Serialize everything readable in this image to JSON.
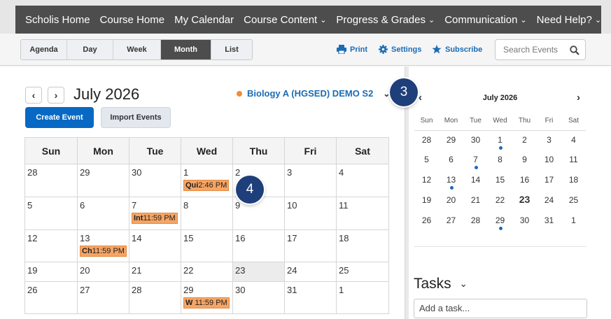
{
  "topnav": {
    "items": [
      {
        "label": "Scholis Home",
        "chevron": false
      },
      {
        "label": "Course Home",
        "chevron": false
      },
      {
        "label": "My Calendar",
        "chevron": false
      },
      {
        "label": "Course Content",
        "chevron": true
      },
      {
        "label": "Progress & Grades",
        "chevron": true
      },
      {
        "label": "Communication",
        "chevron": true
      },
      {
        "label": "Need Help?",
        "chevron": true
      }
    ]
  },
  "toolbar": {
    "views": [
      "Agenda",
      "Day",
      "Week",
      "Month",
      "List"
    ],
    "active_view": "Month",
    "print_label": "Print",
    "settings_label": "Settings",
    "subscribe_label": "Subscribe",
    "search_placeholder": "Search Events"
  },
  "main": {
    "month_title": "July 2026",
    "course_name": "Biology A (HGSED) DEMO S2",
    "create_label": "Create Event",
    "import_label": "Import Events",
    "weekdays": [
      "Sun",
      "Mon",
      "Tue",
      "Wed",
      "Thu",
      "Fri",
      "Sat"
    ],
    "weeks": [
      [
        {
          "d": "28"
        },
        {
          "d": "29"
        },
        {
          "d": "30"
        },
        {
          "d": "1",
          "ev_b": "Qui",
          "ev_t": "2:46 PM"
        },
        {
          "d": "2"
        },
        {
          "d": "3"
        },
        {
          "d": "4"
        }
      ],
      [
        {
          "d": "5"
        },
        {
          "d": "6"
        },
        {
          "d": "7",
          "ev_b": "Int",
          "ev_t": "11:59 PM"
        },
        {
          "d": "8"
        },
        {
          "d": "9"
        },
        {
          "d": "10"
        },
        {
          "d": "11"
        }
      ],
      [
        {
          "d": "12"
        },
        {
          "d": "13",
          "ev_b": "Ch",
          "ev_t": "11:59 PM"
        },
        {
          "d": "14"
        },
        {
          "d": "15"
        },
        {
          "d": "16"
        },
        {
          "d": "17"
        },
        {
          "d": "18"
        }
      ],
      [
        {
          "d": "19"
        },
        {
          "d": "20"
        },
        {
          "d": "21"
        },
        {
          "d": "22"
        },
        {
          "d": "23",
          "today": true
        },
        {
          "d": "24"
        },
        {
          "d": "25"
        }
      ],
      [
        {
          "d": "26"
        },
        {
          "d": "27"
        },
        {
          "d": "28"
        },
        {
          "d": "29",
          "ev_b": "W",
          "ev_t": " 11:59 PM"
        },
        {
          "d": "30"
        },
        {
          "d": "31"
        },
        {
          "d": "1"
        }
      ]
    ]
  },
  "badges": {
    "a": "3",
    "b": "4"
  },
  "mini": {
    "title": "July 2026",
    "weekdays": [
      "Sun",
      "Mon",
      "Tue",
      "Wed",
      "Thu",
      "Fri",
      "Sat"
    ],
    "weeks": [
      [
        {
          "d": "28"
        },
        {
          "d": "29"
        },
        {
          "d": "30"
        },
        {
          "d": "1",
          "dot": true
        },
        {
          "d": "2"
        },
        {
          "d": "3"
        },
        {
          "d": "4"
        }
      ],
      [
        {
          "d": "5"
        },
        {
          "d": "6"
        },
        {
          "d": "7",
          "dot": true
        },
        {
          "d": "8"
        },
        {
          "d": "9"
        },
        {
          "d": "10"
        },
        {
          "d": "11"
        }
      ],
      [
        {
          "d": "12"
        },
        {
          "d": "13",
          "dot": true
        },
        {
          "d": "14"
        },
        {
          "d": "15"
        },
        {
          "d": "16"
        },
        {
          "d": "17"
        },
        {
          "d": "18"
        }
      ],
      [
        {
          "d": "19"
        },
        {
          "d": "20"
        },
        {
          "d": "21"
        },
        {
          "d": "22"
        },
        {
          "d": "23",
          "bold": true
        },
        {
          "d": "24"
        },
        {
          "d": "25"
        }
      ],
      [
        {
          "d": "26"
        },
        {
          "d": "27"
        },
        {
          "d": "28"
        },
        {
          "d": "29",
          "dot": true
        },
        {
          "d": "30"
        },
        {
          "d": "31"
        },
        {
          "d": "1"
        }
      ]
    ]
  },
  "tasks": {
    "title": "Tasks",
    "placeholder": "Add a task..."
  }
}
